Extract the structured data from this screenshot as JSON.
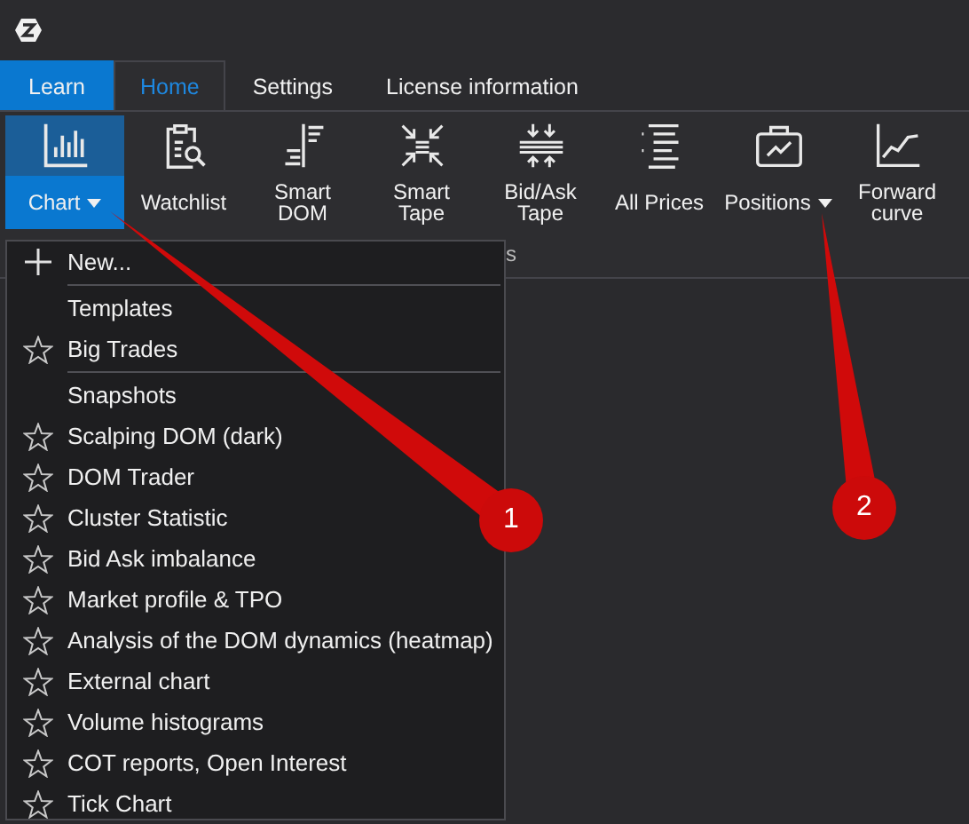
{
  "tabs": [
    {
      "label": "Learn",
      "kind": "accent",
      "selected": false
    },
    {
      "label": "Home",
      "kind": "tab",
      "selected": true
    },
    {
      "label": "Settings",
      "kind": "tab",
      "selected": false
    },
    {
      "label": "License information",
      "kind": "tab",
      "selected": false
    }
  ],
  "ribbon": {
    "buttons": [
      {
        "label": "Chart",
        "selected": true,
        "dropdown": true
      },
      {
        "label": "Watchlist",
        "selected": false,
        "dropdown": false
      },
      {
        "label": "Smart DOM",
        "selected": false,
        "dropdown": false
      },
      {
        "label": "Smart Tape",
        "selected": false,
        "dropdown": false
      },
      {
        "label": "Bid/Ask Tape",
        "selected": false,
        "dropdown": false
      },
      {
        "label": "All Prices",
        "selected": false,
        "dropdown": false
      },
      {
        "label": "Positions",
        "selected": false,
        "dropdown": true
      },
      {
        "label": "Forward curve",
        "selected": false,
        "dropdown": false
      }
    ],
    "group_label": "s"
  },
  "menu": {
    "items": [
      {
        "kind": "new",
        "label": "New..."
      },
      {
        "kind": "header",
        "label": "Templates"
      },
      {
        "kind": "star",
        "label": "Big Trades"
      },
      {
        "kind": "header",
        "label": "Snapshots"
      },
      {
        "kind": "star",
        "label": "Scalping DOM (dark)"
      },
      {
        "kind": "star",
        "label": "DOM Trader"
      },
      {
        "kind": "star",
        "label": "Cluster Statistic"
      },
      {
        "kind": "star",
        "label": "Bid Ask imbalance"
      },
      {
        "kind": "star",
        "label": "Market profile & TPO"
      },
      {
        "kind": "star",
        "label": "Analysis of the DOM dynamics (heatmap)"
      },
      {
        "kind": "star",
        "label": "External chart"
      },
      {
        "kind": "star",
        "label": "Volume histograms"
      },
      {
        "kind": "star",
        "label": "COT reports, Open Interest"
      },
      {
        "kind": "star",
        "label": "Tick Chart"
      }
    ]
  },
  "annotations": [
    {
      "label": "1"
    },
    {
      "label": "2"
    }
  ]
}
